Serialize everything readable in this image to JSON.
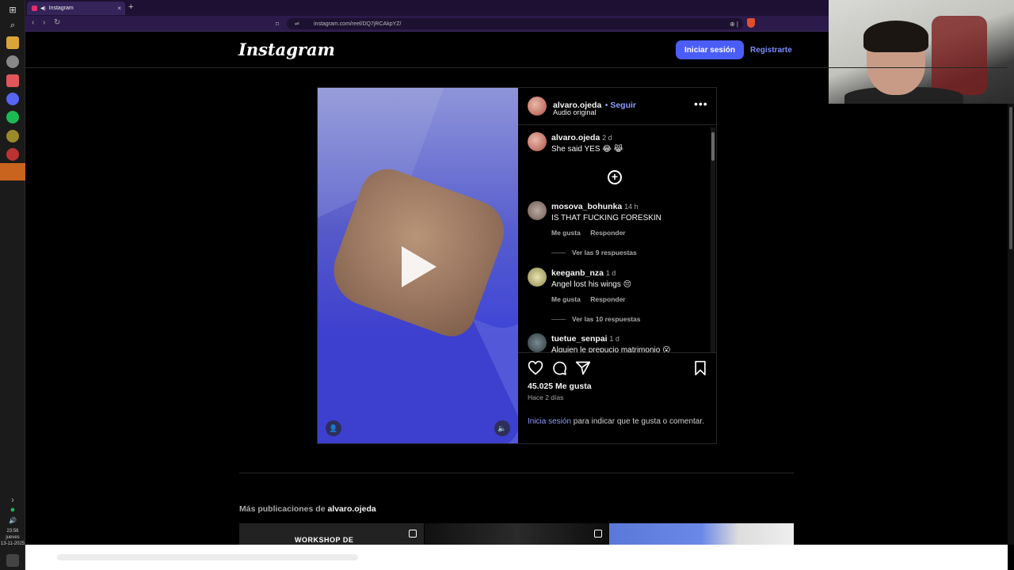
{
  "browser": {
    "tab_title": "Instagram",
    "new_tab": "+",
    "tab_close": "×",
    "url": "instagram.com/reel/DQ7jRCAkpYZ/"
  },
  "taskbar": {
    "time": "23:56",
    "day": "jueves",
    "date": "13-11-2025"
  },
  "header": {
    "logo": "Instagram",
    "login_label": "Iniciar sesión",
    "signup_label": "Registrarte"
  },
  "post": {
    "author": "alvaro.ojeda",
    "follow_label": "• Seguir",
    "audio": "Audio original",
    "caption": {
      "user": "alvaro.ojeda",
      "age": "2 d",
      "text": "She said YES 😂 😹"
    },
    "comments": [
      {
        "user": "mosova_bohunka",
        "age": "14 h",
        "text": "IS THAT FUCKING FORESKIN",
        "like": "Me gusta",
        "reply": "Responder",
        "view_replies": "Ver las 9 respuestas"
      },
      {
        "user": "keeganb_nza",
        "age": "1 d",
        "text": "Angel lost his wings 😔",
        "like": "Me gusta",
        "reply": "Responder",
        "view_replies": "Ver las 10 respuestas"
      },
      {
        "user": "tuetue_senpai",
        "age": "1 d",
        "text": "Alguien le prepucio matrimonio 😮"
      }
    ],
    "likes": "45.025 Me gusta",
    "posted": "Hace 2 días",
    "login_link": "Inicia sesión",
    "login_rest": " para indicar que te gusta o comentar."
  },
  "more": {
    "prefix": "Más publicaciones de ",
    "user": "alvaro.ojeda",
    "thumb1_text": "WORKSHOP DE"
  },
  "colors": {
    "accent": "#4a5df9",
    "link": "#8e9cff",
    "browser_bg": "#1e1033"
  }
}
